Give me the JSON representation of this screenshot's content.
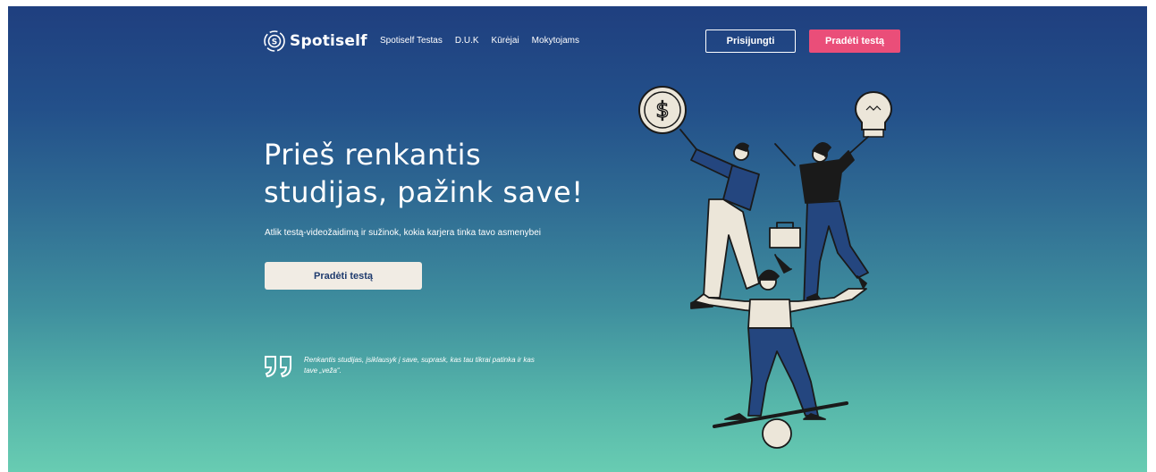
{
  "brand": {
    "name": "Spotiself"
  },
  "nav": {
    "links": [
      "Spotiself Testas",
      "D.U.K",
      "Kūrėjai",
      "Mokytojams"
    ],
    "login_label": "Prisijungti",
    "start_label": "Pradėti testą"
  },
  "hero": {
    "headline_line1": "Prieš renkantis",
    "headline_line2": "studijas, pažink save!",
    "subtitle": "Atlik testą-videožaidimą ir sužinok, kokia karjera tinka tavo asmenybei",
    "cta_label": "Pradėti testą",
    "quote": "Renkantis studijas, įsiklausyk į save, suprask, kas tau tikrai patinka ir kas tave „veža“."
  },
  "colors": {
    "gradient_top": "#1f3f7f",
    "gradient_bottom": "#68ccb2",
    "accent_pink": "#ea4e79",
    "cream": "#f1ece4",
    "navy_text": "#1f3b6e"
  },
  "icons": [
    "spotiself-logo-icon",
    "quote-icon",
    "coin-dollar-icon",
    "lightbulb-icon"
  ]
}
